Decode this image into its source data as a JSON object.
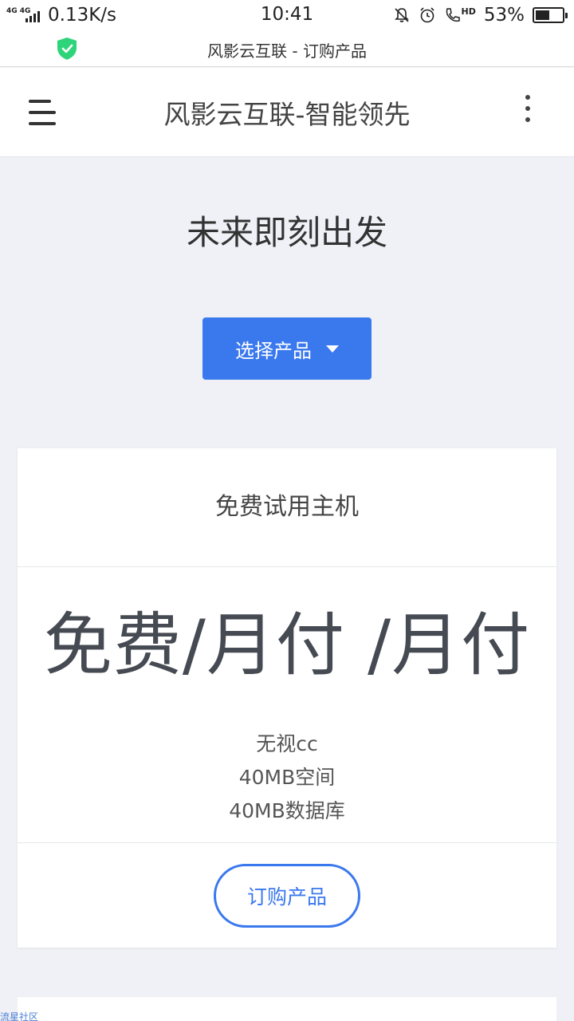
{
  "status_bar": {
    "network_type": "4G 4G",
    "speed": "0.13K/s",
    "time": "10:41",
    "hd_label": "HD",
    "battery_percent": "53%",
    "battery_level": 0.53
  },
  "browser": {
    "page_title": "风影云互联 - 订购产品",
    "secure_color": "#2ed47a"
  },
  "header": {
    "brand": "风影云互联-智能领先"
  },
  "hero": {
    "title": "未来即刻出发",
    "select_label": "选择产品"
  },
  "product_card": {
    "title": "免费试用主机",
    "price": "免费/月付 /月付",
    "features": [
      "无视cc",
      "40MB空间",
      "40MB数据库"
    ],
    "order_label": "订购产品"
  },
  "watermark": "流星社区",
  "colors": {
    "accent": "#3a78ee",
    "background": "#eff1f6"
  }
}
